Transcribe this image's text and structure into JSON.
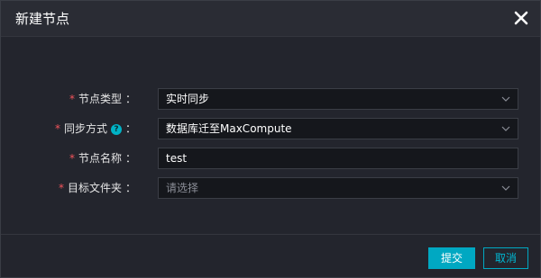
{
  "dialog": {
    "title": "新建节点"
  },
  "form": {
    "node_type": {
      "label": "节点类型",
      "value": "实时同步"
    },
    "sync_method": {
      "label": "同步方式",
      "value": "数据库迁至MaxCompute"
    },
    "node_name": {
      "label": "节点名称",
      "value": "test"
    },
    "target_folder": {
      "label": "目标文件夹",
      "placeholder": "请选择"
    },
    "colon": "：",
    "required_mark": "*"
  },
  "footer": {
    "submit_label": "提交",
    "cancel_label": "取消"
  },
  "colors": {
    "accent": "#00a8c2",
    "required": "#f2545b",
    "background": "#23252d"
  }
}
